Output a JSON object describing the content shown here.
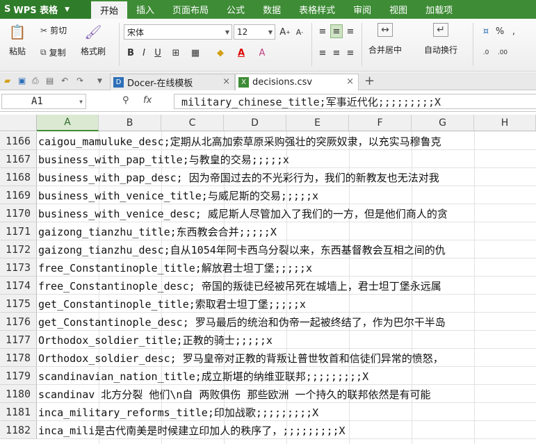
{
  "app": {
    "logo": "WPS 表格"
  },
  "menu": [
    "开始",
    "插入",
    "页面布局",
    "公式",
    "数据",
    "表格样式",
    "审阅",
    "视图",
    "加载项"
  ],
  "ribbon": {
    "paste": "粘贴",
    "cut": "剪切",
    "copy": "复制",
    "format_painter": "格式刷",
    "font_name": "宋体",
    "font_size": "12",
    "merge_center": "合并居中",
    "wrap_text": "自动换行",
    "percent": "%"
  },
  "tabs": [
    {
      "label": "Docer-在线模板",
      "icon": "docer-icon"
    },
    {
      "label": "decisions.csv",
      "icon": "excel-file-icon"
    }
  ],
  "formula_bar": {
    "name_box": "A1",
    "fx": "fx",
    "content": "military_chinese_title;军事近代化;;;;;;;;;X"
  },
  "columns": [
    "A",
    "B",
    "C",
    "D",
    "E",
    "F",
    "G",
    "H"
  ],
  "rows": [
    {
      "num": "1166",
      "text": "caigou_mamuluke_desc;定期从北高加索草原采购强壮的突厥奴隶，以充实马穆鲁克"
    },
    {
      "num": "1167",
      "text": "business_with_pap_title;与教皇的交易;;;;;x"
    },
    {
      "num": "1168",
      "text": "business_with_pap_desc; 因为帝国过去的不光彩行为，我们的新教友也无法对我"
    },
    {
      "num": "1169",
      "text": "business_with_venice_title;与威尼斯的交易;;;;;x"
    },
    {
      "num": "1170",
      "text": "business_with_venice_desc; 威尼斯人尽管加入了我们的一方，但是他们商人的贪"
    },
    {
      "num": "1171",
      "text": "gaizong_tianzhu_title;东西教会合并;;;;;X"
    },
    {
      "num": "1172",
      "text": "gaizong_tianzhu_desc;自从1054年阿卡西乌分裂以来，东西基督教会互相之间的仇"
    },
    {
      "num": "1173",
      "text": "free_Constantinople_title;解放君士坦丁堡;;;;;x"
    },
    {
      "num": "1174",
      "text": "free_Constantinople_desc; 帝国的叛徒已经被吊死在城墙上，君士坦丁堡永远属"
    },
    {
      "num": "1175",
      "text": "get_Constantinople_title;索取君士坦丁堡;;;;;x"
    },
    {
      "num": "1176",
      "text": "get_Constantinople_desc; 罗马最后的统治和伪帝一起被终结了，作为巴尔干半岛"
    },
    {
      "num": "1177",
      "text": "Orthodox_soldier_title;正教的骑士;;;;;x"
    },
    {
      "num": "1178",
      "text": "Orthodox_soldier_desc; 罗马皇帝对正教的背叛让普世牧首和信徒们异常的愤怒，"
    },
    {
      "num": "1179",
      "text": "scandinavian_nation_title;成立斯堪的纳维亚联邦;;;;;;;;;X"
    },
    {
      "num": "1180",
      "text": "scandinav 北方分裂 他们\\n自 两败俱伤 那些欧洲 一个持久的联邦依然是有可能"
    },
    {
      "num": "1181",
      "text": "inca_military_reforms_title;印加战歌;;;;;;;;;X"
    },
    {
      "num": "1182",
      "text": "inca_mili是古代南美是时候建立印加人的秩序了，;;;;;;;;;X"
    }
  ]
}
